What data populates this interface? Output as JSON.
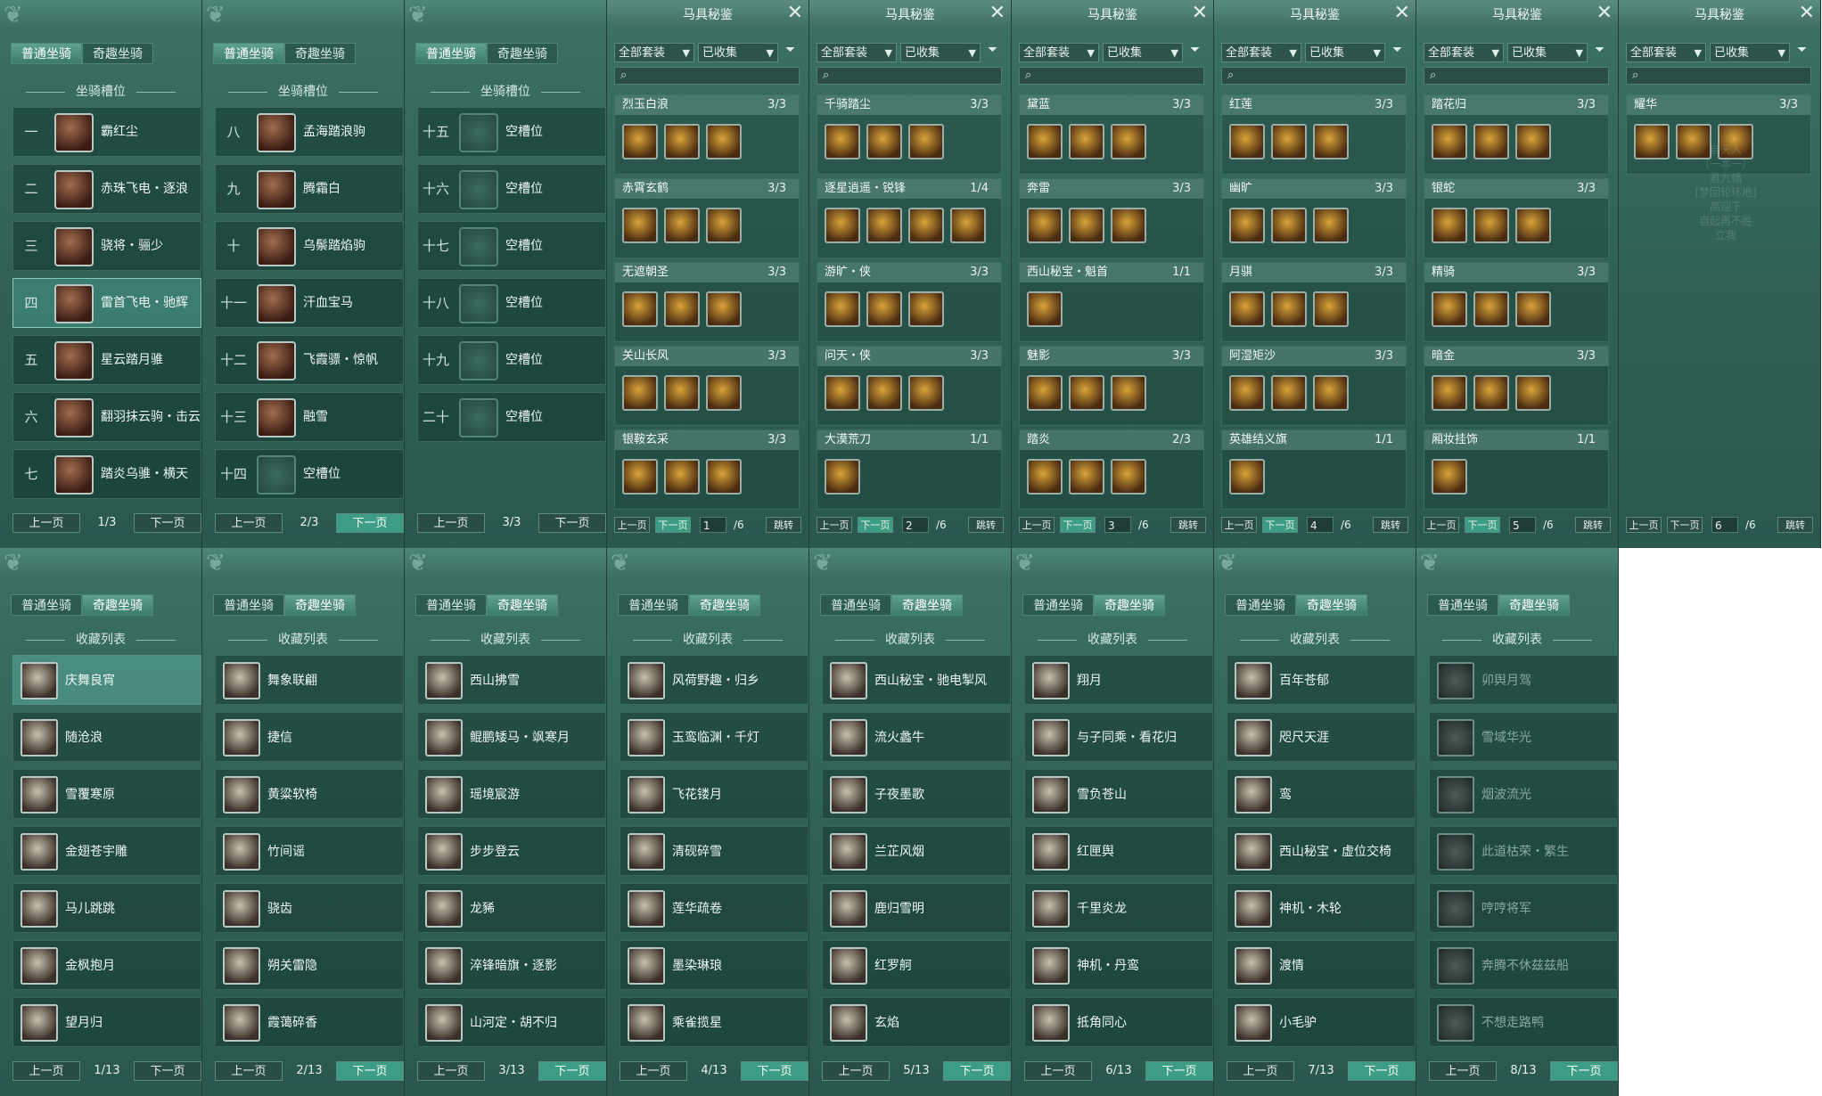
{
  "top_panels": [
    {
      "tabs": [
        "普通坐骑",
        "奇趣坐骑"
      ],
      "section": "坐骑槽位",
      "slots": [
        {
          "num": "一",
          "name": "霸红尘"
        },
        {
          "num": "二",
          "name": "赤珠飞电・逐浪"
        },
        {
          "num": "三",
          "name": "骁将・骊少"
        },
        {
          "num": "四",
          "name": "雷首飞电・驰辉"
        },
        {
          "num": "五",
          "name": "星云踏月骓"
        },
        {
          "num": "六",
          "name": "翻羽抹云驹・击云"
        },
        {
          "num": "七",
          "name": "踏炎乌骓・横天"
        }
      ],
      "prev": "上一页",
      "page": "1/3",
      "next": "下一页"
    },
    {
      "tabs": [
        "普通坐骑",
        "奇趣坐骑"
      ],
      "section": "坐骑槽位",
      "slots": [
        {
          "num": "八",
          "name": "孟海踏浪驹"
        },
        {
          "num": "九",
          "name": "腾霜白"
        },
        {
          "num": "十",
          "name": "乌鬃踏焰驹"
        },
        {
          "num": "十一",
          "name": "汗血宝马"
        },
        {
          "num": "十二",
          "name": "飞霞骠・惊帆"
        },
        {
          "num": "十三",
          "name": "融雪"
        },
        {
          "num": "十四",
          "name": "空槽位"
        }
      ],
      "prev": "上一页",
      "page": "2/3",
      "next": "下一页"
    },
    {
      "tabs": [
        "普通坐骑",
        "奇趣坐骑"
      ],
      "section": "坐骑槽位",
      "slots": [
        {
          "num": "十五",
          "name": "空槽位"
        },
        {
          "num": "十六",
          "name": "空槽位"
        },
        {
          "num": "十七",
          "name": "空槽位"
        },
        {
          "num": "十八",
          "name": "空槽位"
        },
        {
          "num": "十九",
          "name": "空槽位"
        },
        {
          "num": "二十",
          "name": "空槽位"
        }
      ],
      "prev": "上一页",
      "page": "3/3",
      "next": "下一页"
    }
  ],
  "mj_panels": [
    {
      "title": "马具秘鉴",
      "filter1": "全部套装",
      "filter2": "已收集",
      "sets": [
        {
          "name": "烈玉白浪",
          "count": "3/3",
          "n": 3
        },
        {
          "name": "赤霄玄鹤",
          "count": "3/3",
          "n": 3
        },
        {
          "name": "无遮朝圣",
          "count": "3/3",
          "n": 3
        },
        {
          "name": "关山长风",
          "count": "3/3",
          "n": 3
        },
        {
          "name": "银鞍玄采",
          "count": "3/3",
          "n": 3
        }
      ],
      "prev": "上一页",
      "next": "下一页",
      "page": "1",
      "total": "/6",
      "jump": "跳转"
    },
    {
      "title": "马具秘鉴",
      "filter1": "全部套装",
      "filter2": "已收集",
      "sets": [
        {
          "name": "千骑踏尘",
          "count": "3/3",
          "n": 3
        },
        {
          "name": "逐星逍遥・锐锋",
          "count": "1/4",
          "n": 4
        },
        {
          "name": "游旷・侠",
          "count": "3/3",
          "n": 3
        },
        {
          "name": "问天・侠",
          "count": "3/3",
          "n": 3
        },
        {
          "name": "大漠荒刀",
          "count": "1/1",
          "n": 1
        }
      ],
      "prev": "上一页",
      "next": "下一页",
      "page": "2",
      "total": "/6",
      "jump": "跳转"
    },
    {
      "title": "马具秘鉴",
      "filter1": "全部套装",
      "filter2": "已收集",
      "sets": [
        {
          "name": "黛蓝",
          "count": "3/3",
          "n": 3
        },
        {
          "name": "奔雷",
          "count": "3/3",
          "n": 3
        },
        {
          "name": "西山秘宝・魁首",
          "count": "1/1",
          "n": 1
        },
        {
          "name": "魅影",
          "count": "3/3",
          "n": 3
        },
        {
          "name": "踏炎",
          "count": "2/3",
          "n": 3
        }
      ],
      "prev": "上一页",
      "next": "下一页",
      "page": "3",
      "total": "/6",
      "jump": "跳转"
    },
    {
      "title": "马具秘鉴",
      "filter1": "全部套装",
      "filter2": "已收集",
      "sets": [
        {
          "name": "红莲",
          "count": "3/3",
          "n": 3
        },
        {
          "name": "幽旷",
          "count": "3/3",
          "n": 3
        },
        {
          "name": "月骐",
          "count": "3/3",
          "n": 3
        },
        {
          "name": "阿湿矩沙",
          "count": "3/3",
          "n": 3
        },
        {
          "name": "英雄结义旗",
          "count": "1/1",
          "n": 1
        }
      ],
      "prev": "上一页",
      "next": "下一页",
      "page": "4",
      "total": "/6",
      "jump": "跳转"
    },
    {
      "title": "马具秘鉴",
      "filter1": "全部套装",
      "filter2": "已收集",
      "sets": [
        {
          "name": "踏花归",
          "count": "3/3",
          "n": 3
        },
        {
          "name": "银蛇",
          "count": "3/3",
          "n": 3
        },
        {
          "name": "精骑",
          "count": "3/3",
          "n": 3
        },
        {
          "name": "暗金",
          "count": "3/3",
          "n": 3
        },
        {
          "name": "厢妆挂饰",
          "count": "1/1",
          "n": 1
        }
      ],
      "prev": "上一页",
      "next": "下一页",
      "page": "5",
      "total": "/6",
      "jump": "跳转"
    },
    {
      "title": "马具秘鉴",
      "filter1": "全部套装",
      "filter2": "已收集",
      "sets": [
        {
          "name": "耀华",
          "count": "3/3",
          "n": 3
        }
      ],
      "prev": "上一页",
      "next": "下一页",
      "page": "6",
      "total": "/6",
      "jump": "跳转"
    }
  ],
  "collection_panels": [
    {
      "tabs": [
        "普通坐骑",
        "奇趣坐骑"
      ],
      "section": "收藏列表",
      "items": [
        "庆舞良宵",
        "随沧浪",
        "雪覆寒原",
        "金翅苍宇雕",
        "马儿跳跳",
        "金枫抱月",
        "望月归"
      ],
      "prev": "上一页",
      "page": "1/13",
      "next": "下一页"
    },
    {
      "tabs": [
        "普通坐骑",
        "奇趣坐骑"
      ],
      "section": "收藏列表",
      "items": [
        "舞象联翩",
        "捷信",
        "黄粱软椅",
        "竹间谣",
        "骁齿",
        "朔关雷隐",
        "霞蔼碎香"
      ],
      "prev": "上一页",
      "page": "2/13",
      "next": "下一页"
    },
    {
      "tabs": [
        "普通坐骑",
        "奇趣坐骑"
      ],
      "section": "收藏列表",
      "items": [
        "西山拂雪",
        "鲲鹏矮马・飒寒月",
        "瑶境宸游",
        "步步登云",
        "龙豨",
        "淬锋暗旗・逐影",
        "山河定・胡不归"
      ],
      "prev": "上一页",
      "page": "3/13",
      "next": "下一页"
    },
    {
      "tabs": [
        "普通坐骑",
        "奇趣坐骑"
      ],
      "section": "收藏列表",
      "items": [
        "风荷野趣・归乡",
        "玉鸾临渊・千灯",
        "飞花镂月",
        "清砚碎雪",
        "莲华疏卷",
        "墨染琳琅",
        "乘雀揽星"
      ],
      "prev": "上一页",
      "page": "4/13",
      "next": "下一页"
    },
    {
      "tabs": [
        "普通坐骑",
        "奇趣坐骑"
      ],
      "section": "收藏列表",
      "items": [
        "西山秘宝・驰电掣风",
        "流火蠡牛",
        "子夜墨歌",
        "兰芷风烟",
        "鹿归雪明",
        "红罗舸",
        "玄焰"
      ],
      "prev": "上一页",
      "page": "5/13",
      "next": "下一页"
    },
    {
      "tabs": [
        "普通坐骑",
        "奇趣坐骑"
      ],
      "section": "收藏列表",
      "items": [
        "翔月",
        "与子同乘・看花归",
        "雪负苍山",
        "红匣舆",
        "千里炎龙",
        "神机・丹鸾",
        "抵角同心"
      ],
      "prev": "上一页",
      "page": "6/13",
      "next": "下一页"
    },
    {
      "tabs": [
        "普通坐骑",
        "奇趣坐骑"
      ],
      "section": "收藏列表",
      "items": [
        "百年苍郁",
        "咫尺天涯",
        "鸾",
        "西山秘宝・虚位交椅",
        "神机・木轮",
        "渡情",
        "小毛驴"
      ],
      "prev": "上一页",
      "page": "7/13",
      "next": "下一页"
    },
    {
      "tabs": [
        "普通坐骑",
        "奇趣坐骑"
      ],
      "section": "收藏列表",
      "items": [
        "卯舆月驾",
        "雪域华光",
        "烟波流光",
        "此道枯荣・繁生",
        "哼哼将军",
        "奔腾不休兹兹船",
        "不想走路鸭"
      ],
      "prev": "上一页",
      "page": "8/13",
      "next": "下一页",
      "dim": true
    }
  ],
  "ghost_text": [
    "自天入",
    "（一本一）",
    "君九幡",
    "[梦回轮环地]",
    "高迎下",
    "自起再不胜",
    "立我"
  ]
}
